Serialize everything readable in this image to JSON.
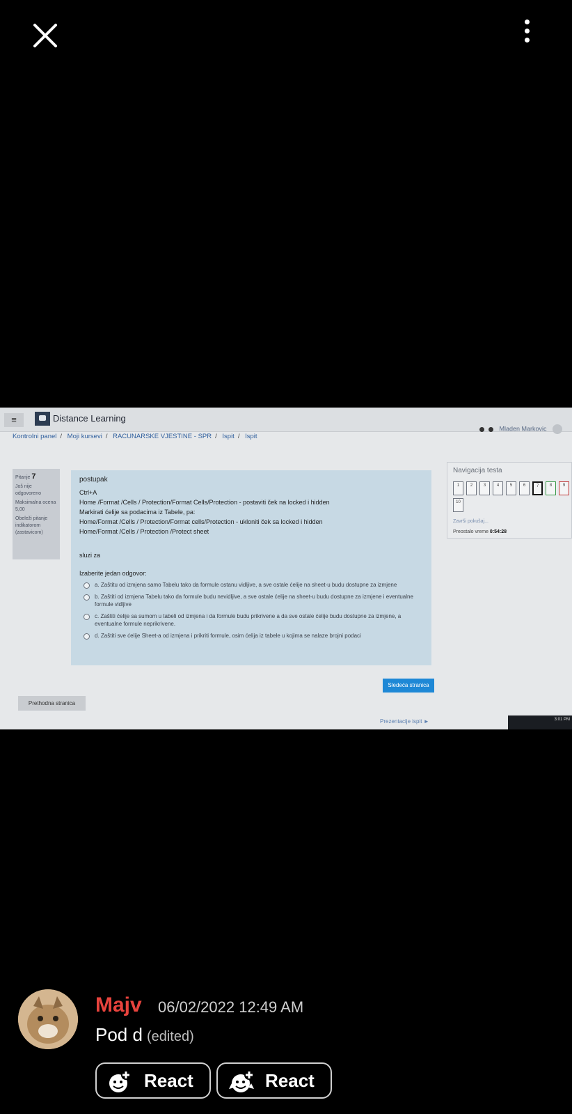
{
  "viewer": {
    "close_icon": "close-icon",
    "more_icon": "more-vertical-icon"
  },
  "moodle": {
    "brand": "Distance Learning",
    "user_name": "Mladen Markovic",
    "breadcrumb": [
      "Kontrolni panel",
      "Moji kursevi",
      "RACUNARSKE VJESTINE - SPR",
      "Ispit",
      "Ispit"
    ],
    "question_info": {
      "label": "Pitanje",
      "number": "7",
      "status": "Još nije odgovoreno",
      "max_label": "Maksimalna ocena 5,00",
      "flag_label": "Obeleži pitanje indikatorom (zastavicom)"
    },
    "question": {
      "title": "postupak",
      "steps": [
        "Ctrl+A",
        "Home /Format /Cells / Protection/Format Cells/Protection - postaviti ček na locked i hidden",
        "Markirati ćelije sa podacima iz Tabele, pa:",
        "Home/Format /Cells / Protection/Format cells/Protection - ukloniti ček sa locked i hidden",
        "Home/Format /Cells / Protection /Protect sheet"
      ],
      "purpose": "sluzi za",
      "prompt": "Izaberite jedan odgovor:",
      "options": [
        "a.  Zaštitu od izmjena samo Tabelu  tako da formule ostanu vidljive, a sve ostale ćelije na sheet-u budu dostupne za izmjene",
        "b. Zaštiti od izmjena Tabelu  tako da formule budu nevidljive, a sve ostale ćelije na sheet-u budu dostupne za izmjene i eventualne formule vidljive",
        "c. Zaštiti ćelije sa sumom u tabeli od izmjena i da formule budu prikrivene a da sve ostale ćelije budu dostupne za izmjene, a eventualne formule neprikrivene.",
        "d.  Zaštiti sve ćelije Sheet-a od izmjena i prikriti formule, osim ćelija iz tabele  u kojima se nalaze brojni podaci"
      ]
    },
    "next_button": "Sledeća stranica",
    "prev_button": "Prethodna stranica",
    "footer_link": "Prezentacije ispit ►",
    "navigation": {
      "title": "Navigacija testa",
      "cells": [
        "1",
        "2",
        "3",
        "4",
        "5",
        "6",
        "7",
        "8",
        "9",
        "10"
      ],
      "current": "7",
      "finish_link": "Završi pokušaj...",
      "time_label": "Preostalo vreme",
      "time_value": "0:54:28"
    },
    "taskbar_time": "3:01 PM"
  },
  "message": {
    "username": "Majv",
    "username_color": "#e8433d",
    "timestamp": "06/02/2022 12:49 AM",
    "text": "Pod d",
    "edited": "(edited)",
    "react_buttons": [
      "React",
      "React"
    ]
  }
}
